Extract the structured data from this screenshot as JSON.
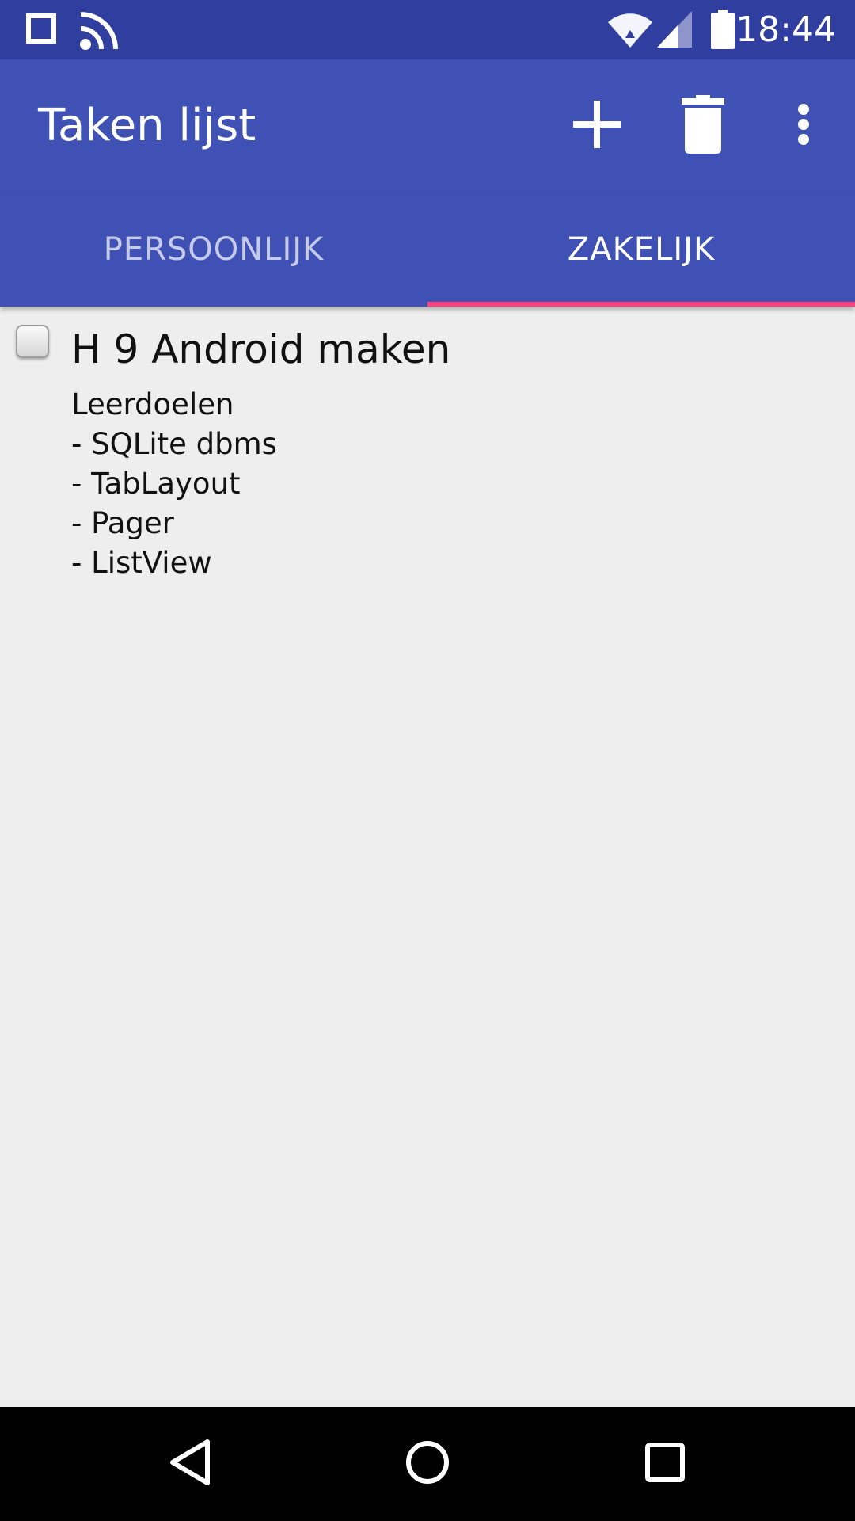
{
  "status_bar": {
    "time": "18:44",
    "icons": [
      "square-notification-icon",
      "cast-icon",
      "wifi-icon",
      "cell-signal-icon",
      "battery-icon"
    ]
  },
  "app_bar": {
    "title": "Taken lijst",
    "actions": [
      "add-icon",
      "delete-icon",
      "overflow-menu-icon"
    ]
  },
  "tabs": [
    {
      "label": "PERSOONLIJK",
      "selected": false
    },
    {
      "label": "ZAKELIJK",
      "selected": true
    }
  ],
  "tasks": [
    {
      "checked": false,
      "title": "H 9 Android maken",
      "description": [
        "Leerdoelen",
        "- SQLite dbms",
        "- TabLayout",
        "- Pager",
        "- ListView"
      ]
    }
  ],
  "nav_bar": {
    "buttons": [
      "back-icon",
      "home-icon",
      "recents-icon"
    ]
  },
  "colors": {
    "status_bar": "#303f9f",
    "primary": "#3f51b5",
    "accent": "#ff4081",
    "background": "#eeeeee"
  }
}
